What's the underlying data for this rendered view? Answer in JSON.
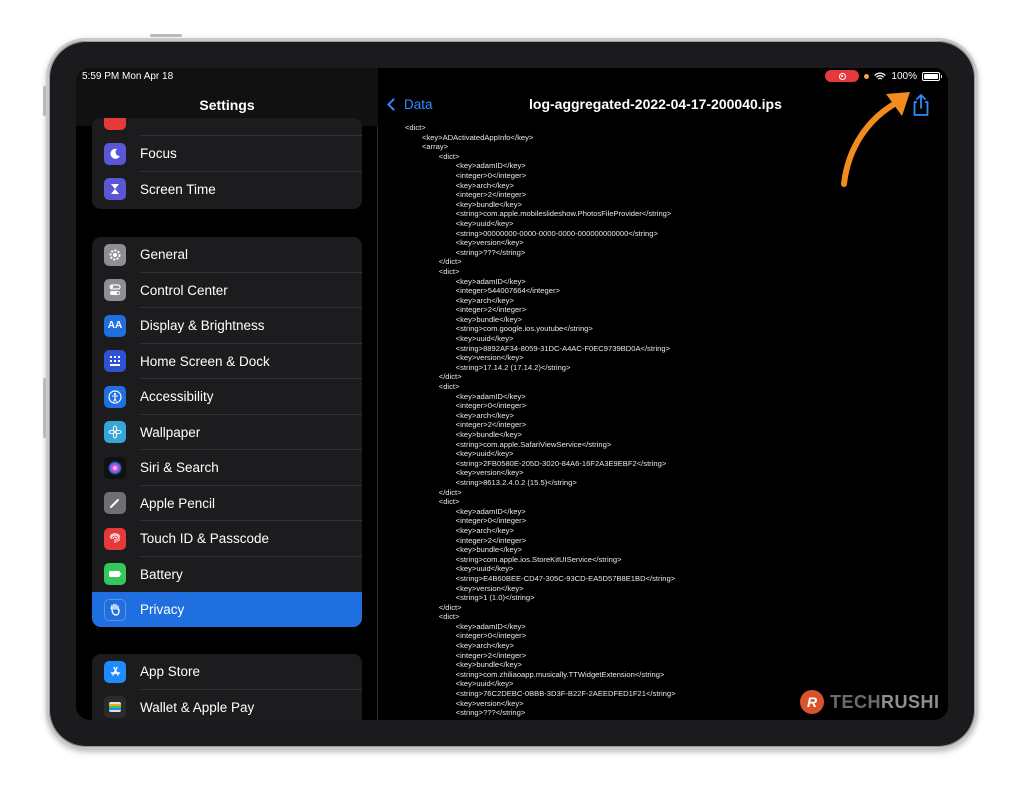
{
  "status": {
    "time": "5:59 PM  Mon Apr 18",
    "battery": "100%"
  },
  "sidebar": {
    "title": "Settings",
    "group1": [
      {
        "label": "Focus",
        "icon": "moon-icon",
        "color": "#5b56d6"
      },
      {
        "label": "Screen Time",
        "icon": "hourglass-icon",
        "color": "#5b56d6"
      }
    ],
    "group2": [
      {
        "label": "General",
        "icon": "gear-icon",
        "color": "#8e8e93"
      },
      {
        "label": "Control Center",
        "icon": "toggles-icon",
        "color": "#8e8e93"
      },
      {
        "label": "Display & Brightness",
        "icon": "text-size-icon",
        "color": "#1f6fe0"
      },
      {
        "label": "Home Screen & Dock",
        "icon": "grid-icon",
        "color": "#1f6fe0"
      },
      {
        "label": "Accessibility",
        "icon": "accessibility-icon",
        "color": "#1f6fe0"
      },
      {
        "label": "Wallpaper",
        "icon": "flower-icon",
        "color": "#35a6d8"
      },
      {
        "label": "Siri & Search",
        "icon": "siri-icon",
        "color": "#222"
      },
      {
        "label": "Apple Pencil",
        "icon": "pencil-icon",
        "color": "#6e6e73"
      },
      {
        "label": "Touch ID & Passcode",
        "icon": "fingerprint-icon",
        "color": "#e5393b"
      },
      {
        "label": "Battery",
        "icon": "battery-icon",
        "color": "#34c759"
      },
      {
        "label": "Privacy",
        "icon": "hand-icon",
        "color": "#1f6fe0"
      }
    ],
    "group3": [
      {
        "label": "App Store",
        "icon": "app-store-icon",
        "color": "#1f8bff"
      },
      {
        "label": "Wallet & Apple Pay",
        "icon": "wallet-icon",
        "color": "#2c2c2e"
      }
    ],
    "selected": "Privacy"
  },
  "main": {
    "back_label": "Data",
    "title": "log-aggregated-2022-04-17-200040.ips",
    "code": "<dict>\n        <key>ADActivatedAppInfo</key>\n        <array>\n                <dict>\n                        <key>adamID</key>\n                        <integer>0</integer>\n                        <key>arch</key>\n                        <integer>2</integer>\n                        <key>bundle</key>\n                        <string>com.apple.mobileslideshow.PhotosFileProvider</string>\n                        <key>uuid</key>\n                        <string>00000000-0000-0000-0000-000000000000</string>\n                        <key>version</key>\n                        <string>???</string>\n                </dict>\n                <dict>\n                        <key>adamID</key>\n                        <integer>544007664</integer>\n                        <key>arch</key>\n                        <integer>2</integer>\n                        <key>bundle</key>\n                        <string>com.google.ios.youtube</string>\n                        <key>uuid</key>\n                        <string>8892AF34-8059-31DC-A4AC-F0EC9739BD0A</string>\n                        <key>version</key>\n                        <string>17.14.2 (17.14.2)</string>\n                </dict>\n                <dict>\n                        <key>adamID</key>\n                        <integer>0</integer>\n                        <key>arch</key>\n                        <integer>2</integer>\n                        <key>bundle</key>\n                        <string>com.apple.SafariViewService</string>\n                        <key>uuid</key>\n                        <string>2FB0580E-205D-3020-84A6-16F2A3E9EBF2</string>\n                        <key>version</key>\n                        <string>8613.2.4.0.2 (15.5)</string>\n                </dict>\n                <dict>\n                        <key>adamID</key>\n                        <integer>0</integer>\n                        <key>arch</key>\n                        <integer>2</integer>\n                        <key>bundle</key>\n                        <string>com.apple.ios.StoreKitUIService</string>\n                        <key>uuid</key>\n                        <string>E4B60BEE-CD47-305C-93CD-EA5D57B8E1BD</string>\n                        <key>version</key>\n                        <string>1 (1.0)</string>\n                </dict>\n                <dict>\n                        <key>adamID</key>\n                        <integer>0</integer>\n                        <key>arch</key>\n                        <integer>2</integer>\n                        <key>bundle</key>\n                        <string>com.zhiliaoapp.musically.TTWidgetExtension</string>\n                        <key>uuid</key>\n                        <string>76C2DEBC-0BBB-3D3F-B22F-2AEEDFED1F21</string>\n                        <key>version</key>\n                        <string>???</string>"
  },
  "watermark": {
    "part1": "TECH",
    "part2": "RUSHI",
    "logo_letter": "R"
  },
  "colors": {
    "accent": "#2f8bff",
    "arrow": "#f28c1e",
    "selected": "#1f6fe0"
  }
}
